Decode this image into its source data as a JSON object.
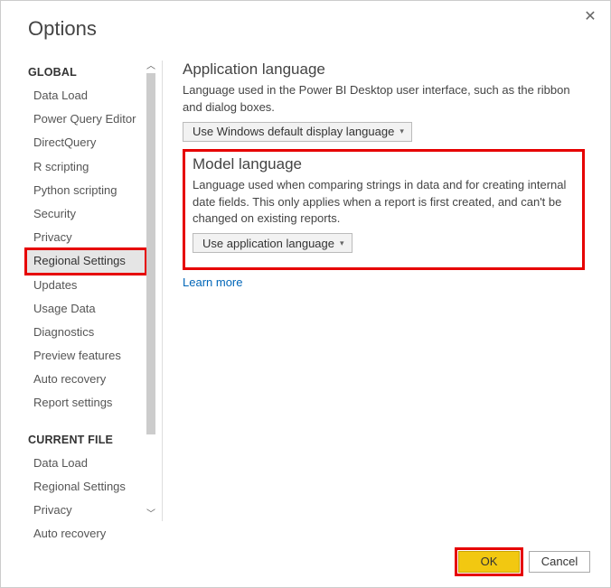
{
  "dialog": {
    "title": "Options"
  },
  "sidebar": {
    "sections": [
      {
        "header": "GLOBAL",
        "items": [
          "Data Load",
          "Power Query Editor",
          "DirectQuery",
          "R scripting",
          "Python scripting",
          "Security",
          "Privacy",
          "Regional Settings",
          "Updates",
          "Usage Data",
          "Diagnostics",
          "Preview features",
          "Auto recovery",
          "Report settings"
        ],
        "selected_index": 7
      },
      {
        "header": "CURRENT FILE",
        "items": [
          "Data Load",
          "Regional Settings",
          "Privacy",
          "Auto recovery"
        ]
      }
    ]
  },
  "content": {
    "app_lang": {
      "heading": "Application language",
      "desc": "Language used in the Power BI Desktop user interface, such as the ribbon and dialog boxes.",
      "dropdown_value": "Use Windows default display language"
    },
    "model_lang": {
      "heading": "Model language",
      "desc": "Language used when comparing strings in data and for creating internal date fields. This only applies when a report is first created, and can't be changed on existing reports.",
      "dropdown_value": "Use application language"
    },
    "learn_more": "Learn more"
  },
  "footer": {
    "ok": "OK",
    "cancel": "Cancel"
  }
}
